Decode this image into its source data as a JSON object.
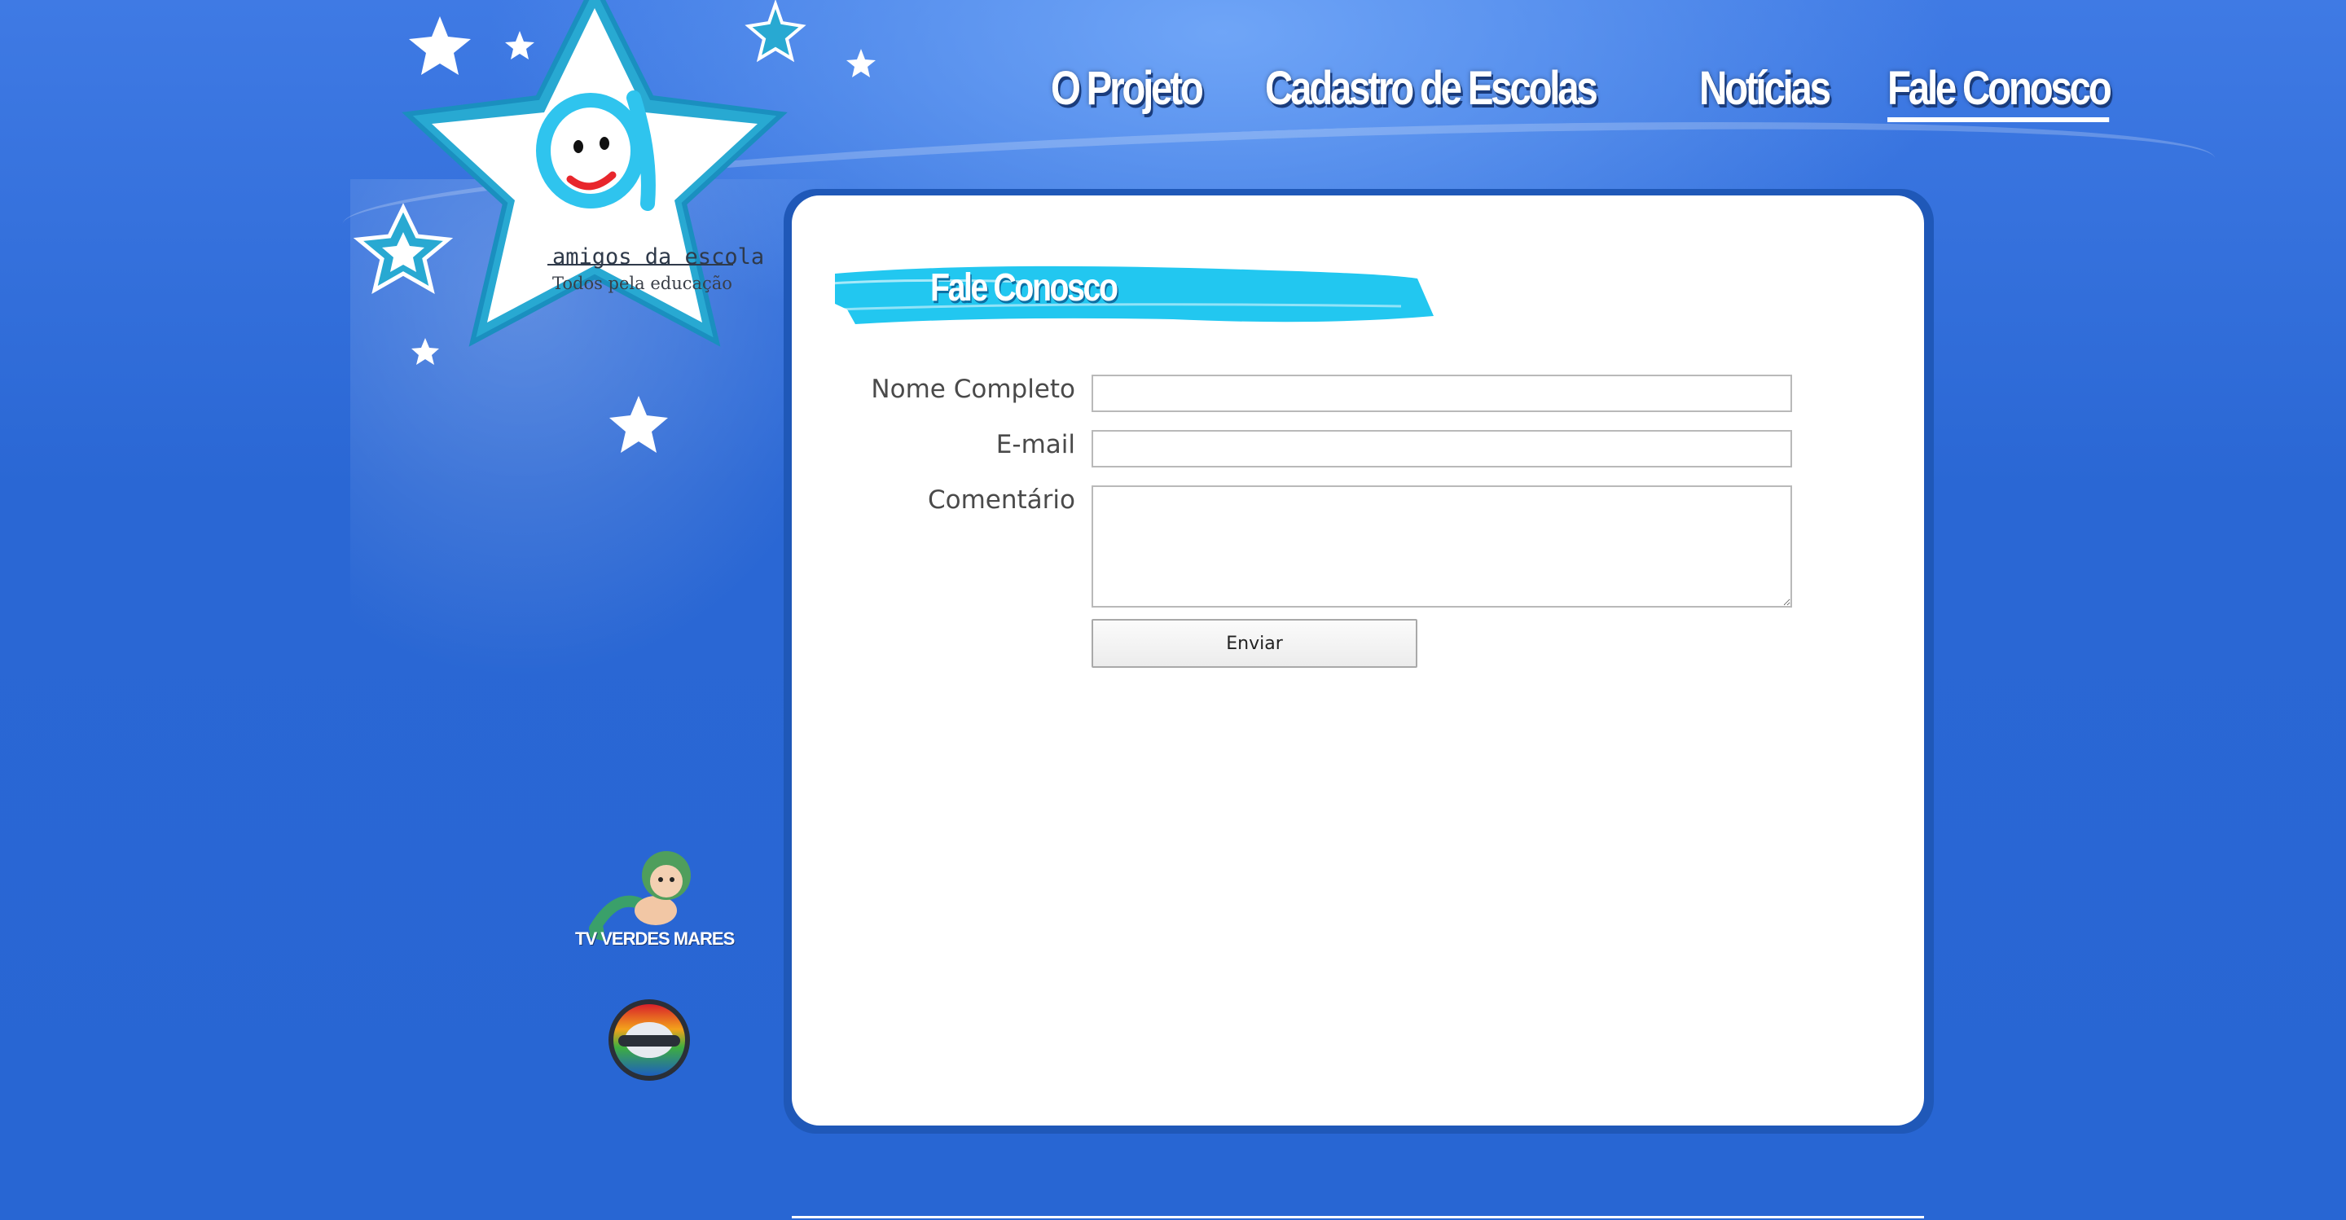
{
  "nav": {
    "items": [
      {
        "label": "O Projeto"
      },
      {
        "label": "Cadastro de Escolas"
      },
      {
        "label": "Notícias"
      },
      {
        "label": "Fale Conosco",
        "active": true
      }
    ]
  },
  "logo": {
    "name": "amigos da escola",
    "tagline": "Todos pela educação",
    "icon": "star-logo-icon"
  },
  "sponsors": {
    "tv": {
      "label": "TV VERDES MARES",
      "icon": "mermaid-mascot-icon"
    },
    "globo": {
      "icon": "globo-logo-icon"
    }
  },
  "contact": {
    "title": "Fale Conosco",
    "name_label": "Nome Completo",
    "name_value": "",
    "email_label": "E-mail",
    "email_value": "",
    "comment_label": "Comentário",
    "comment_value": "",
    "submit_label": "Enviar"
  },
  "colors": {
    "background": "#2a67d4",
    "brush_accent": "#22c7f0",
    "panel": "#ffffff"
  }
}
